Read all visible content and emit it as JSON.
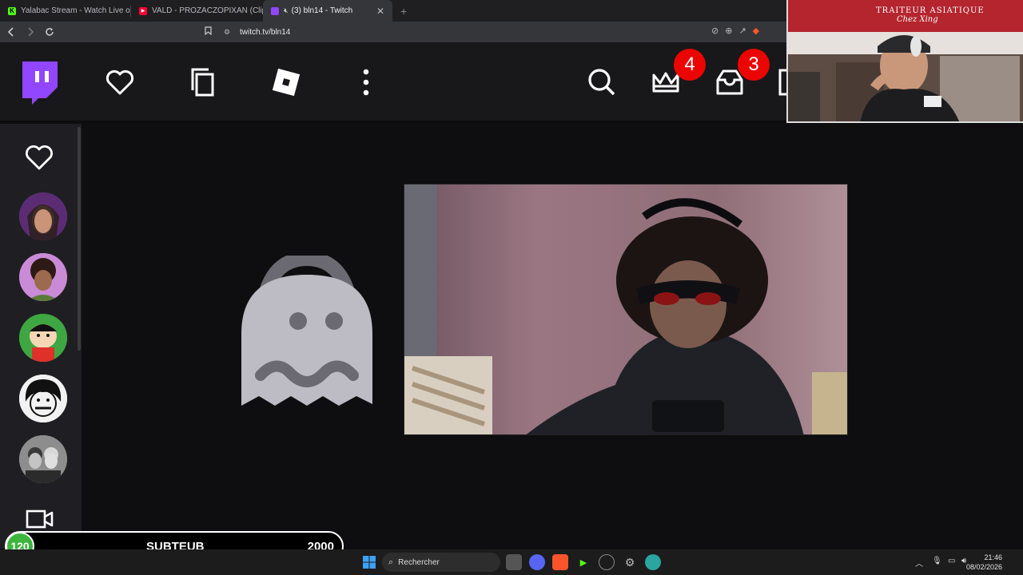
{
  "browser": {
    "tabs": [
      {
        "title": "Yalabac Stream - Watch Live on Kick",
        "favicon_color": "#53fc18",
        "favicon_letter": "K",
        "active": false
      },
      {
        "title": "VALD - PROZACZOPIXAN (Clip offici",
        "favicon_color": "#ff0033",
        "favicon_letter": "▶",
        "active": false
      },
      {
        "title": "(3) bln14 - Twitch",
        "favicon_color": "#9146ff",
        "favicon_letter": "",
        "active": true
      }
    ],
    "url": "twitch.tv/bln14"
  },
  "twitch_nav": {
    "brand_color": "#9146ff",
    "icons": [
      "twitch-logo-icon",
      "heart-icon",
      "browse-copy-icon",
      "roblox-icon",
      "more-vertical-icon",
      "search-icon",
      "crown-icon",
      "inbox-icon"
    ],
    "crown_badge": "4",
    "inbox_badge": "3"
  },
  "sidebar": {
    "items": [
      {
        "kind": "heart",
        "name": "following-heart-icon"
      },
      {
        "kind": "avatar",
        "name": "channel-avatar-1",
        "color": "#7a3c8f"
      },
      {
        "kind": "avatar",
        "name": "channel-avatar-2",
        "color": "#b06bc2"
      },
      {
        "kind": "avatar",
        "name": "channel-avatar-3",
        "color": "#3ea342"
      },
      {
        "kind": "avatar",
        "name": "channel-avatar-4",
        "color": "#f4f4f4"
      },
      {
        "kind": "avatar",
        "name": "channel-avatar-5",
        "color": "#9a9a9a"
      }
    ]
  },
  "offline_ghost_color": "#bdbcc4",
  "sub_goal": {
    "current": "120",
    "label": "SUBTEUB",
    "target": "2000",
    "accent": "#3db53d"
  },
  "webcam_sign": "TRAITEUR ASIATIQUE",
  "webcam_sign2": "Chez Xing",
  "taskbar": {
    "search_placeholder": "Rechercher",
    "time": "21:46",
    "date": "08/02/2026"
  }
}
